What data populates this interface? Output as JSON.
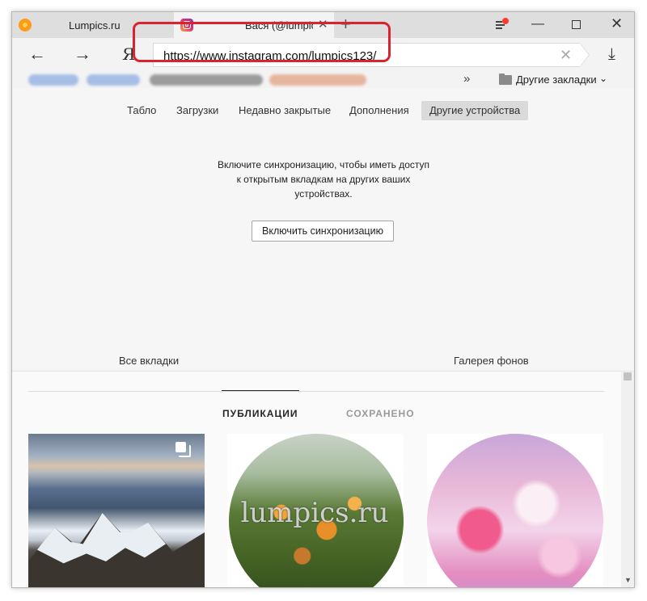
{
  "tabs": [
    {
      "title": "Lumpics.ru",
      "favicon": "lumpics-icon"
    },
    {
      "title": "Вася (@lumpics",
      "favicon": "instagram-icon",
      "close": "✕"
    }
  ],
  "new_tab": "+",
  "toolbar": {
    "back": "←",
    "forward": "→",
    "yandex": "Я",
    "url": "https://www.instagram.com/lumpics123/",
    "clear": "✕",
    "download": "⤓"
  },
  "bookmarks": {
    "more": "»",
    "other": "Другие закладки",
    "chevron": "⌄"
  },
  "panel": {
    "tabs": [
      "Табло",
      "Загрузки",
      "Недавно закрытые",
      "Дополнения",
      "Другие устройства"
    ],
    "active_tab": "Другие устройства",
    "sync_message": [
      "Включите синхронизацию, чтобы иметь доступ",
      "к открытым вкладкам на других ваших",
      "устройствах."
    ],
    "sync_button": "Включить синхронизацию",
    "all_tabs": "Все вкладки",
    "gallery": "Галерея фонов"
  },
  "instagram": {
    "tabs": [
      "ПУБЛИКАЦИИ",
      "СОХРАНЕНО"
    ],
    "active_tab": "ПУБЛИКАЦИИ",
    "watermark": "lumpics.ru"
  },
  "colors": {
    "highlight": "#d9232f",
    "active_nav_tab_bg": "#dadada"
  }
}
